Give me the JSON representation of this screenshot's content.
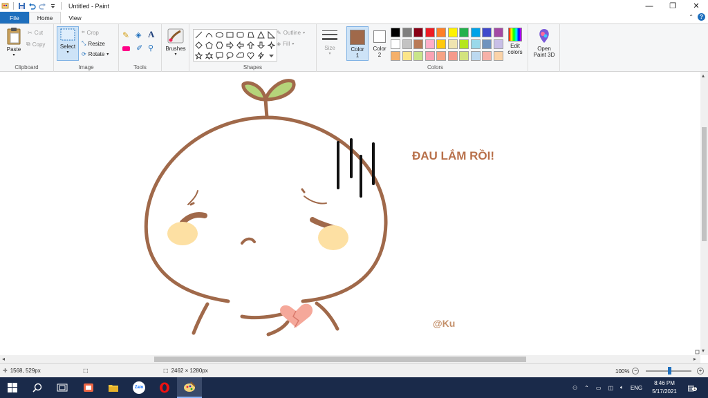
{
  "window": {
    "title": "Untitled - Paint",
    "minimize": "—",
    "restore": "❐",
    "close": "✕"
  },
  "tabs": {
    "file": "File",
    "home": "Home",
    "view": "View"
  },
  "ribbon": {
    "clipboard": {
      "label": "Clipboard",
      "paste": "Paste",
      "cut": "Cut",
      "copy": "Copy"
    },
    "image": {
      "label": "Image",
      "select": "Select",
      "crop": "Crop",
      "resize": "Resize",
      "rotate": "Rotate"
    },
    "tools": {
      "label": "Tools"
    },
    "brushes": {
      "label": "Brushes"
    },
    "shapes": {
      "label": "Shapes",
      "outline": "Outline",
      "fill": "Fill"
    },
    "size": {
      "label": "Size"
    },
    "colors": {
      "label": "Colors",
      "color1": "Color 1",
      "color1_line1": "Color",
      "color1_line2": "1",
      "color2_line1": "Color",
      "color2_line2": "2",
      "color1_value": "#a0694a",
      "color2_value": "#ffffff",
      "edit_line1": "Edit",
      "edit_line2": "colors",
      "palette": [
        "#000000",
        "#7f7f7f",
        "#880015",
        "#ed1c24",
        "#ff7f27",
        "#fff200",
        "#22b14c",
        "#00a2e8",
        "#3f48cc",
        "#a349a4",
        "#ffffff",
        "#c3c3c3",
        "#b97a57",
        "#ffaec9",
        "#ffc90e",
        "#efe4b0",
        "#b5e61d",
        "#99d9ea",
        "#7092be",
        "#c8bfe7",
        "#f5b06a",
        "#fbe58a",
        "#c9e58a",
        "#f9a3b4",
        "#f6a385",
        "#f59a8b",
        "#d3e37f",
        "#bcd9f0",
        "#f7b1a8",
        "#fbd3a8"
      ]
    },
    "paint3d": {
      "line1": "Open",
      "line2": "Paint 3D"
    }
  },
  "canvas": {
    "caption": "ĐAU LẮM RỒI!",
    "signature": "@Ku",
    "colors": {
      "outline": "#a0694a",
      "leaf": "#b5d47a",
      "blush": "#fde0a3",
      "heart": "#f5a89a",
      "caption": "#b8704a"
    }
  },
  "status": {
    "cursor": "1568, 529px",
    "canvas_size": "2462 × 1280px",
    "zoom": "100%"
  },
  "taskbar": {
    "apps": [
      "start-icon",
      "search-icon",
      "task-view-icon",
      "snip-icon",
      "file-explorer-icon",
      "zalo-icon",
      "opera-icon",
      "paint-icon"
    ],
    "zalo_label": "Zalo",
    "lang": "ENG",
    "time": "8:46 PM",
    "date": "5/17/2021",
    "notifications": "1"
  }
}
